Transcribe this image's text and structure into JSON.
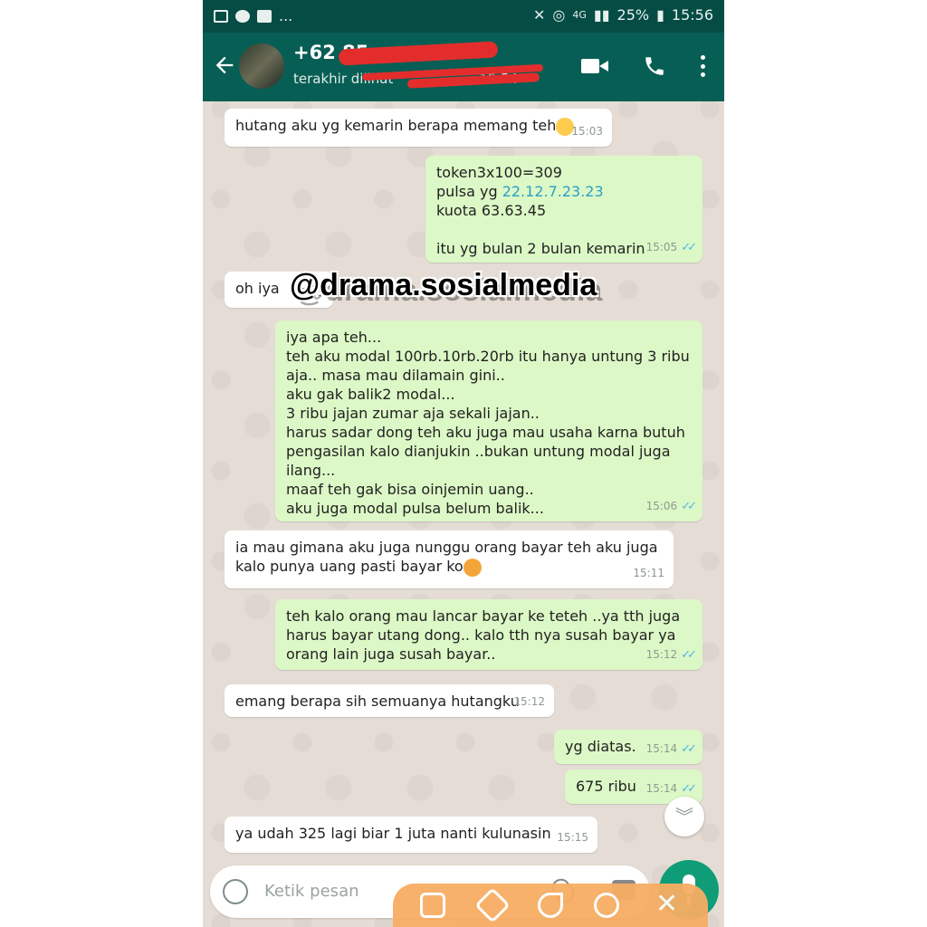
{
  "status_bar": {
    "network": "4G",
    "battery": "25%",
    "time": "15:56",
    "more": "..."
  },
  "header": {
    "contact_name": "+62 85",
    "contact_status": "terakhir dilihat",
    "status_time": "15.54"
  },
  "watermark": "@drama.sosialmedia",
  "messages": [
    {
      "side": "in",
      "text": "hutang aku yg kemarin berapa memang teh",
      "time": "15:03"
    },
    {
      "side": "out",
      "text_lines": [
        "token3x100=309"
      ],
      "pulsa_prefix": "pulsa yg ",
      "pulsa_values": "22.12.7.23.23",
      "text_after": "kuota 63.63.45\n\nitu yg bulan 2 bulan kemarin",
      "time": "15:05"
    },
    {
      "side": "in",
      "text": "oh iya",
      "time": "15:05"
    },
    {
      "side": "out",
      "text": "iya apa teh...\nteh aku modal 100rb.10rb.20rb itu hanya untung 3 ribu\naja.. masa mau dilamain gini..\naku gak balik2 modal...\n3 ribu jajan zumar aja sekali jajan..\nharus sadar dong teh aku juga mau usaha karna butuh\npengasilan kalo dianjukin ..bukan untung modal juga\nilang...\nmaaf teh gak bisa oinjemin uang..\naku juga modal pulsa belum balik...",
      "time": "15:06"
    },
    {
      "side": "in",
      "text": "ia mau gimana aku juga nunggu orang bayar teh aku juga\nkalo punya uang pasti bayar ko",
      "time": "15:11"
    },
    {
      "side": "out",
      "text": "teh kalo orang mau lancar bayar ke teteh ..ya tth juga\nharus bayar utang dong.. kalo tth nya susah bayar ya\norang lain juga susah bayar..",
      "time": "15:12"
    },
    {
      "side": "in",
      "text": "emang berapa sih semuanya hutangku",
      "time": "15:12"
    },
    {
      "side": "out",
      "text": "yg diatas.",
      "time": "15:14"
    },
    {
      "side": "out",
      "text": "675 ribu",
      "time": "15:14"
    },
    {
      "side": "in",
      "text": "ya udah 325 lagi biar 1 juta nanti kulunasin",
      "time": "15:15"
    }
  ],
  "input": {
    "placeholder": "Ketik pesan"
  },
  "colors": {
    "header": "#075e54",
    "statusbar": "#054d44",
    "outgoing_bubble": "#dcf8c6",
    "incoming_bubble": "#ffffff",
    "read_ticks": "#4fb6ec",
    "mic_button": "#0f9d77",
    "overlay_toolbar": "#f7ad63"
  },
  "icons": {
    "back": "arrow-left-icon",
    "video_call": "video-call-icon",
    "voice_call": "phone-icon",
    "menu": "more-vert-icon",
    "emoji": "emoji-icon",
    "attach": "paperclip-icon",
    "camera": "camera-icon",
    "mic": "mic-icon",
    "scroll_down": "double-chevron-down-icon"
  }
}
